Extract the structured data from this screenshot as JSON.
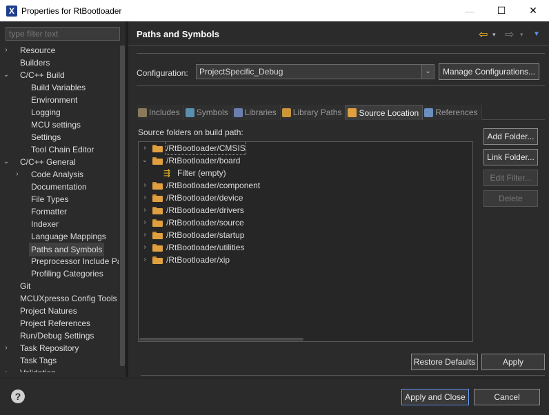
{
  "window": {
    "title": "Properties for RtBootloader",
    "icon": "app-x-icon",
    "controls": {
      "minimize": "—",
      "maximize": "☐",
      "close": "✕"
    }
  },
  "filter": {
    "placeholder": "type filter text"
  },
  "tree": [
    {
      "label": "Resource",
      "chev": "›",
      "level": 0
    },
    {
      "label": "Builders",
      "chev": "",
      "level": 0
    },
    {
      "label": "C/C++ Build",
      "chev": "⌄",
      "level": 0
    },
    {
      "label": "Build Variables",
      "chev": "",
      "level": 1
    },
    {
      "label": "Environment",
      "chev": "",
      "level": 1
    },
    {
      "label": "Logging",
      "chev": "",
      "level": 1
    },
    {
      "label": "MCU settings",
      "chev": "",
      "level": 1
    },
    {
      "label": "Settings",
      "chev": "",
      "level": 1
    },
    {
      "label": "Tool Chain Editor",
      "chev": "",
      "level": 1
    },
    {
      "label": "C/C++ General",
      "chev": "⌄",
      "level": 0
    },
    {
      "label": "Code Analysis",
      "chev": "›",
      "level": 1
    },
    {
      "label": "Documentation",
      "chev": "",
      "level": 1
    },
    {
      "label": "File Types",
      "chev": "",
      "level": 1
    },
    {
      "label": "Formatter",
      "chev": "",
      "level": 1
    },
    {
      "label": "Indexer",
      "chev": "",
      "level": 1
    },
    {
      "label": "Language Mappings",
      "chev": "",
      "level": 1
    },
    {
      "label": "Paths and Symbols",
      "chev": "",
      "level": 1,
      "selected": true
    },
    {
      "label": "Preprocessor Include Pa",
      "chev": "",
      "level": 1
    },
    {
      "label": "Profiling Categories",
      "chev": "",
      "level": 1
    },
    {
      "label": "Git",
      "chev": "",
      "level": 0
    },
    {
      "label": "MCUXpresso Config Tools",
      "chev": "",
      "level": 0
    },
    {
      "label": "Project Natures",
      "chev": "",
      "level": 0
    },
    {
      "label": "Project References",
      "chev": "",
      "level": 0
    },
    {
      "label": "Run/Debug Settings",
      "chev": "",
      "level": 0
    },
    {
      "label": "Task Repository",
      "chev": "›",
      "level": 0
    },
    {
      "label": "Task Tags",
      "chev": "",
      "level": 0
    },
    {
      "label": "Validation",
      "chev": "›",
      "level": 0
    }
  ],
  "page": {
    "title": "Paths and Symbols",
    "nav": {
      "back": "⇦",
      "forward": "⇨",
      "dropdown": "▾",
      "menu": "▼"
    }
  },
  "config": {
    "label": "Configuration:",
    "selected": "ProjectSpecific_Debug",
    "manage_button": "Manage Configurations..."
  },
  "tabs": [
    {
      "label": "Includes",
      "icon": "includes-icon",
      "color": "#8a7a5a"
    },
    {
      "label": "Symbols",
      "icon": "symbols-icon",
      "color": "#5a8fb0"
    },
    {
      "label": "Libraries",
      "icon": "libraries-icon",
      "color": "#6a7fb0"
    },
    {
      "label": "Library Paths",
      "icon": "library-paths-icon",
      "color": "#c9963a"
    },
    {
      "label": "Source Location",
      "icon": "source-location-icon",
      "color": "#e0a040",
      "active": true
    },
    {
      "label": "References",
      "icon": "references-icon",
      "color": "#6a8fc0"
    }
  ],
  "source": {
    "label": "Source folders on build path:",
    "rows": [
      {
        "label": "/RtBootloader/CMSIS",
        "chev": "›",
        "kind": "folder",
        "level": 0,
        "focus": true
      },
      {
        "label": "/RtBootloader/board",
        "chev": "⌄",
        "kind": "folder",
        "level": 0
      },
      {
        "label": "Filter (empty)",
        "chev": "",
        "kind": "filter",
        "level": 1
      },
      {
        "label": "/RtBootloader/component",
        "chev": "›",
        "kind": "folder",
        "level": 0
      },
      {
        "label": "/RtBootloader/device",
        "chev": "›",
        "kind": "folder",
        "level": 0
      },
      {
        "label": "/RtBootloader/drivers",
        "chev": "›",
        "kind": "folder",
        "level": 0
      },
      {
        "label": "/RtBootloader/source",
        "chev": "›",
        "kind": "folder",
        "level": 0
      },
      {
        "label": "/RtBootloader/startup",
        "chev": "›",
        "kind": "folder",
        "level": 0
      },
      {
        "label": "/RtBootloader/utilities",
        "chev": "›",
        "kind": "folder",
        "level": 0
      },
      {
        "label": "/RtBootloader/xip",
        "chev": "›",
        "kind": "folder",
        "level": 0
      }
    ],
    "filter_glyph": "⇶"
  },
  "side_buttons": {
    "add_folder": "Add Folder...",
    "link_folder": "Link Folder...",
    "edit_filter": "Edit Filter...",
    "delete": "Delete"
  },
  "page_buttons": {
    "restore": "Restore Defaults",
    "apply": "Apply"
  },
  "dialog_buttons": {
    "help": "?",
    "apply_close": "Apply and Close",
    "cancel": "Cancel"
  }
}
